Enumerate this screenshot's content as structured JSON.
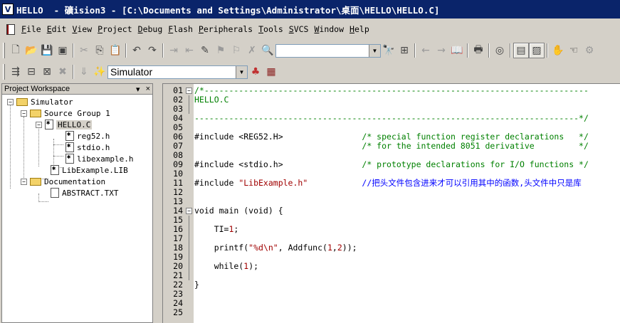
{
  "window": {
    "title": "HELLO  - 礦ision3 - [C:\\Documents and Settings\\Administrator\\桌面\\HELLO\\HELLO.C]"
  },
  "menu": [
    "File",
    "Edit",
    "View",
    "Project",
    "Debug",
    "Flash",
    "Peripherals",
    "Tools",
    "SVCS",
    "Window",
    "Help"
  ],
  "toolbar": {
    "find_combo_value": "",
    "target_combo_value": "Simulator"
  },
  "workspace": {
    "header": "Project Workspace",
    "pin": "▾",
    "close": "×",
    "tree": {
      "root": "Simulator",
      "group1": "Source Group 1",
      "hello_c": "HELLO.C",
      "reg52": "reg52.h",
      "stdio": "stdio.h",
      "libexample_h": "libexample.h",
      "lib": "LibExample.LIB",
      "docs": "Documentation",
      "abstract": "ABSTRACT.TXT"
    }
  },
  "editor": {
    "lines": [
      {
        "n": "01",
        "fold": "box",
        "text": "/*------------------------------------------------------------------------------",
        "cls": "cmt"
      },
      {
        "n": "02",
        "fold": "bar",
        "text": "HELLO.C",
        "cls": "cmt"
      },
      {
        "n": "03",
        "fold": "bar",
        "text": "",
        "cls": "cmt"
      },
      {
        "n": "04",
        "fold": "",
        "text": "------------------------------------------------------------------------------*/",
        "cls": "cmt"
      },
      {
        "n": "05",
        "fold": "",
        "text": "",
        "cls": ""
      },
      {
        "n": "06",
        "fold": "",
        "text": "#include <REG52.H>                /* special function register declarations   */",
        "cls": "mix1"
      },
      {
        "n": "07",
        "fold": "",
        "text": "                                  /* for the intended 8051 derivative         */",
        "cls": "cmt"
      },
      {
        "n": "08",
        "fold": "",
        "text": "",
        "cls": ""
      },
      {
        "n": "09",
        "fold": "",
        "text": "#include <stdio.h>                /* prototype declarations for I/O functions */",
        "cls": "mix1"
      },
      {
        "n": "10",
        "fold": "",
        "text": "",
        "cls": ""
      },
      {
        "n": "11",
        "fold": "",
        "text": "#include \"LibExample.h\"           //把头文件包含进来才可以引用其中的函数,头文件中只是库",
        "cls": "mix2"
      },
      {
        "n": "12",
        "fold": "",
        "text": "",
        "cls": ""
      },
      {
        "n": "13",
        "fold": "",
        "text": "",
        "cls": ""
      },
      {
        "n": "14",
        "fold": "box",
        "text": "void main (void) {",
        "cls": "kw"
      },
      {
        "n": "15",
        "fold": "bar",
        "text": "",
        "cls": ""
      },
      {
        "n": "16",
        "fold": "bar",
        "text": "    TI=1;",
        "cls": "kw"
      },
      {
        "n": "17",
        "fold": "bar",
        "text": "",
        "cls": ""
      },
      {
        "n": "18",
        "fold": "bar",
        "text": "    printf(\"%d\\n\", Addfunc(1,2));",
        "cls": "kw"
      },
      {
        "n": "19",
        "fold": "bar",
        "text": "",
        "cls": ""
      },
      {
        "n": "20",
        "fold": "bar",
        "text": "    while(1);",
        "cls": "kw"
      },
      {
        "n": "21",
        "fold": "bar",
        "text": "",
        "cls": ""
      },
      {
        "n": "22",
        "fold": "",
        "text": "}",
        "cls": "kw"
      },
      {
        "n": "23",
        "fold": "",
        "text": "",
        "cls": ""
      },
      {
        "n": "24",
        "fold": "",
        "text": "",
        "cls": ""
      },
      {
        "n": "25",
        "fold": "",
        "text": "",
        "cls": ""
      }
    ]
  }
}
